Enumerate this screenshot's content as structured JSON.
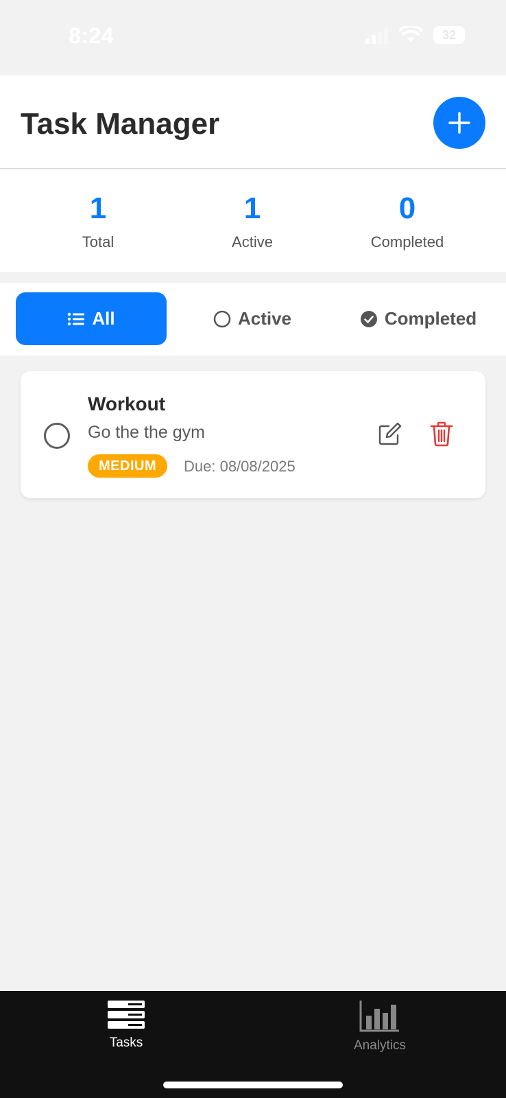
{
  "status": {
    "time": "8:24",
    "battery": "32"
  },
  "header": {
    "title": "Task Manager"
  },
  "stats": [
    {
      "value": "1",
      "label": "Total"
    },
    {
      "value": "1",
      "label": "Active"
    },
    {
      "value": "0",
      "label": "Completed"
    }
  ],
  "filters": [
    {
      "label": "All",
      "icon": "list-icon",
      "selected": true
    },
    {
      "label": "Active",
      "icon": "circle-outline-icon",
      "selected": false
    },
    {
      "label": "Completed",
      "icon": "check-circle-icon",
      "selected": false
    }
  ],
  "tasks": [
    {
      "title": "Workout",
      "description": "Go the the gym",
      "priority": "MEDIUM",
      "due": "Due: 08/08/2025",
      "completed": false
    }
  ],
  "tabbar": {
    "items": [
      {
        "label": "Tasks",
        "icon": "tasks-icon",
        "selected": true
      },
      {
        "label": "Analytics",
        "icon": "bar-chart-icon",
        "selected": false
      }
    ]
  },
  "colors": {
    "accent": "#0a7bff",
    "priority_medium": "#ffa800",
    "delete": "#e53935",
    "tabbar_bg": "#111111"
  }
}
